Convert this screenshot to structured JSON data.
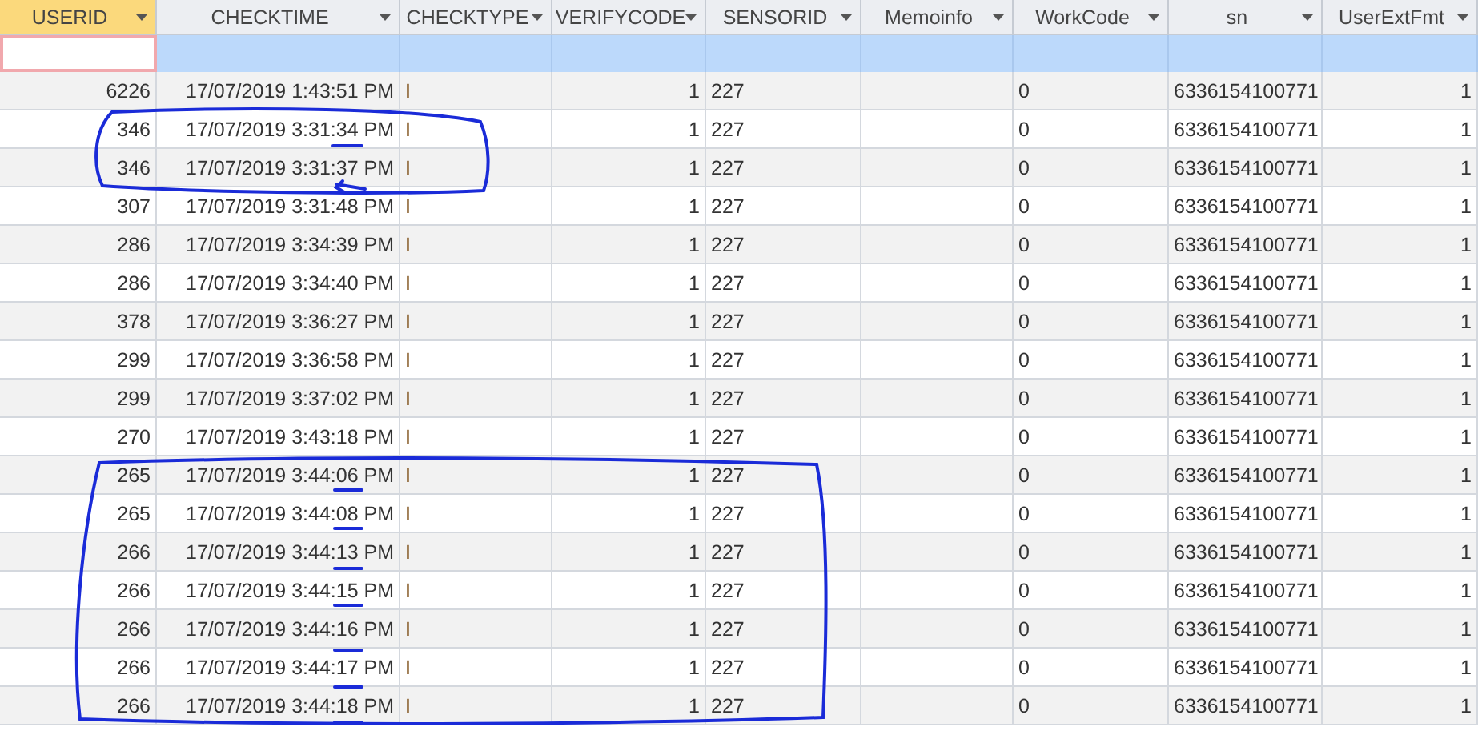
{
  "columns": [
    {
      "label": "USERID",
      "kind": "number",
      "selected": true
    },
    {
      "label": "CHECKTIME",
      "kind": "number",
      "selected": false
    },
    {
      "label": "CHECKTYPE",
      "kind": "text",
      "selected": false
    },
    {
      "label": "VERIFYCODE",
      "kind": "number",
      "selected": false
    },
    {
      "label": "SENSORID",
      "kind": "text",
      "selected": false
    },
    {
      "label": "Memoinfo",
      "kind": "text",
      "selected": false
    },
    {
      "label": "WorkCode",
      "kind": "text",
      "selected": false
    },
    {
      "label": "sn",
      "kind": "text",
      "selected": false
    },
    {
      "label": "UserExtFmt",
      "kind": "number",
      "selected": false
    }
  ],
  "rows": [
    [
      "6226",
      "17/07/2019 1:43:51 PM",
      "I",
      "1",
      "227",
      "",
      "0",
      "6336154100771",
      "1"
    ],
    [
      "346",
      "17/07/2019 3:31:34 PM",
      "I",
      "1",
      "227",
      "",
      "0",
      "6336154100771",
      "1"
    ],
    [
      "346",
      "17/07/2019 3:31:37 PM",
      "I",
      "1",
      "227",
      "",
      "0",
      "6336154100771",
      "1"
    ],
    [
      "307",
      "17/07/2019 3:31:48 PM",
      "I",
      "1",
      "227",
      "",
      "0",
      "6336154100771",
      "1"
    ],
    [
      "286",
      "17/07/2019 3:34:39 PM",
      "I",
      "1",
      "227",
      "",
      "0",
      "6336154100771",
      "1"
    ],
    [
      "286",
      "17/07/2019 3:34:40 PM",
      "I",
      "1",
      "227",
      "",
      "0",
      "6336154100771",
      "1"
    ],
    [
      "378",
      "17/07/2019 3:36:27 PM",
      "I",
      "1",
      "227",
      "",
      "0",
      "6336154100771",
      "1"
    ],
    [
      "299",
      "17/07/2019 3:36:58 PM",
      "I",
      "1",
      "227",
      "",
      "0",
      "6336154100771",
      "1"
    ],
    [
      "299",
      "17/07/2019 3:37:02 PM",
      "I",
      "1",
      "227",
      "",
      "0",
      "6336154100771",
      "1"
    ],
    [
      "270",
      "17/07/2019 3:43:18 PM",
      "I",
      "1",
      "227",
      "",
      "0",
      "6336154100771",
      "1"
    ],
    [
      "265",
      "17/07/2019 3:44:06 PM",
      "I",
      "1",
      "227",
      "",
      "0",
      "6336154100771",
      "1"
    ],
    [
      "265",
      "17/07/2019 3:44:08 PM",
      "I",
      "1",
      "227",
      "",
      "0",
      "6336154100771",
      "1"
    ],
    [
      "266",
      "17/07/2019 3:44:13 PM",
      "I",
      "1",
      "227",
      "",
      "0",
      "6336154100771",
      "1"
    ],
    [
      "266",
      "17/07/2019 3:44:15 PM",
      "I",
      "1",
      "227",
      "",
      "0",
      "6336154100771",
      "1"
    ],
    [
      "266",
      "17/07/2019 3:44:16 PM",
      "I",
      "1",
      "227",
      "",
      "0",
      "6336154100771",
      "1"
    ],
    [
      "266",
      "17/07/2019 3:44:17 PM",
      "I",
      "1",
      "227",
      "",
      "0",
      "6336154100771",
      "1"
    ],
    [
      "266",
      "17/07/2019 3:44:18 PM",
      "I",
      "1",
      "227",
      "",
      "0",
      "6336154100771",
      "1"
    ]
  ]
}
